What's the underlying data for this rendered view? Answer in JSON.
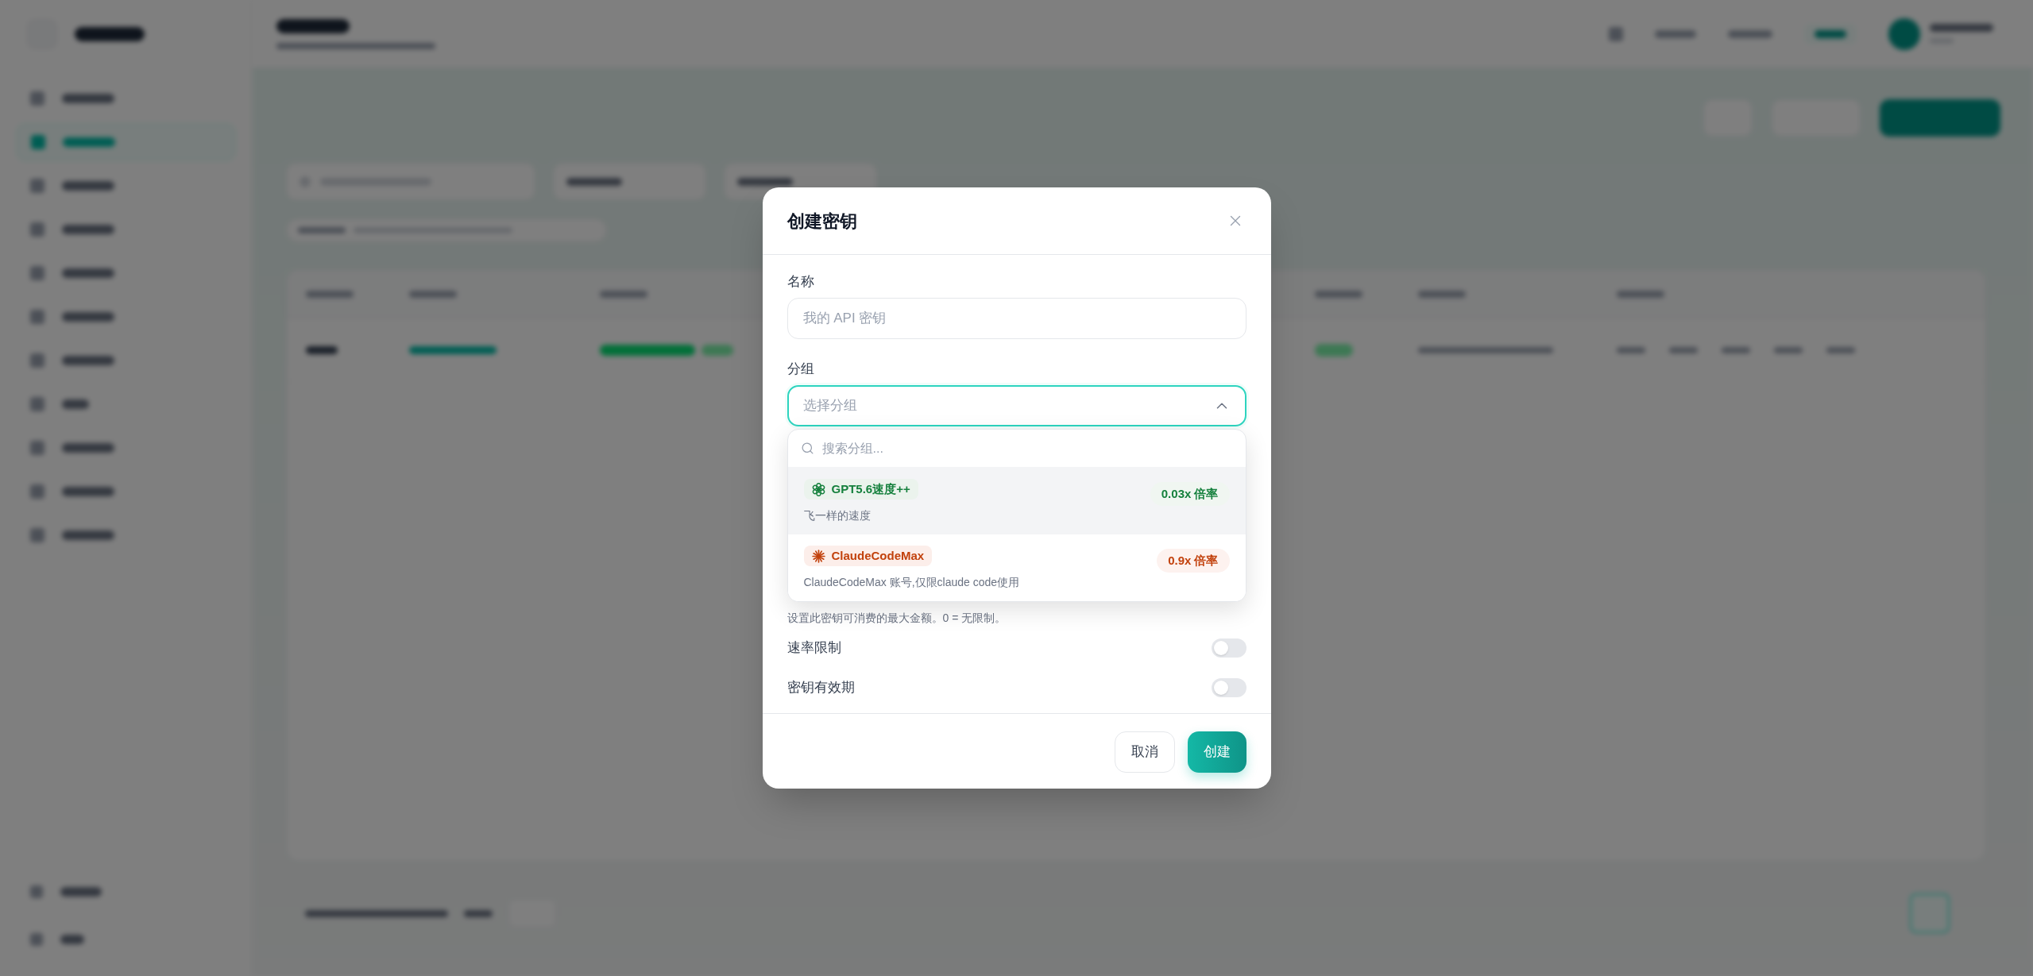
{
  "dialog": {
    "title": "创建密钥",
    "fields": [
      {
        "kind": "text",
        "label": "名称",
        "placeholder": "我的 API 密钥"
      },
      {
        "kind": "select",
        "label": "分组",
        "placeholder": "选择分组",
        "expanded": true,
        "dropdown": {
          "search_placeholder": "搜索分组...",
          "options": [
            {
              "kind": "gpt",
              "name": "GPT5.6速度++",
              "rate": "0.03x 倍率",
              "description": "飞一样的速度",
              "color": "#15803d",
              "highlighted": true
            },
            {
              "kind": "claude",
              "name": "ClaudeCodeMax",
              "rate": "0.9x 倍率",
              "description": "ClaudeCodeMax 账号,仅限claude code使用",
              "color": "#c2410c",
              "highlighted": false
            }
          ]
        }
      }
    ],
    "hint": "设置此密钥可消费的最大金额。0 = 无限制。",
    "toggles": [
      {
        "label": "速率限制",
        "on": false
      },
      {
        "label": "密钥有效期",
        "on": false
      }
    ],
    "buttons": [
      {
        "kind": "secondary",
        "label": "取消"
      },
      {
        "kind": "primary",
        "label": "创建"
      }
    ]
  }
}
